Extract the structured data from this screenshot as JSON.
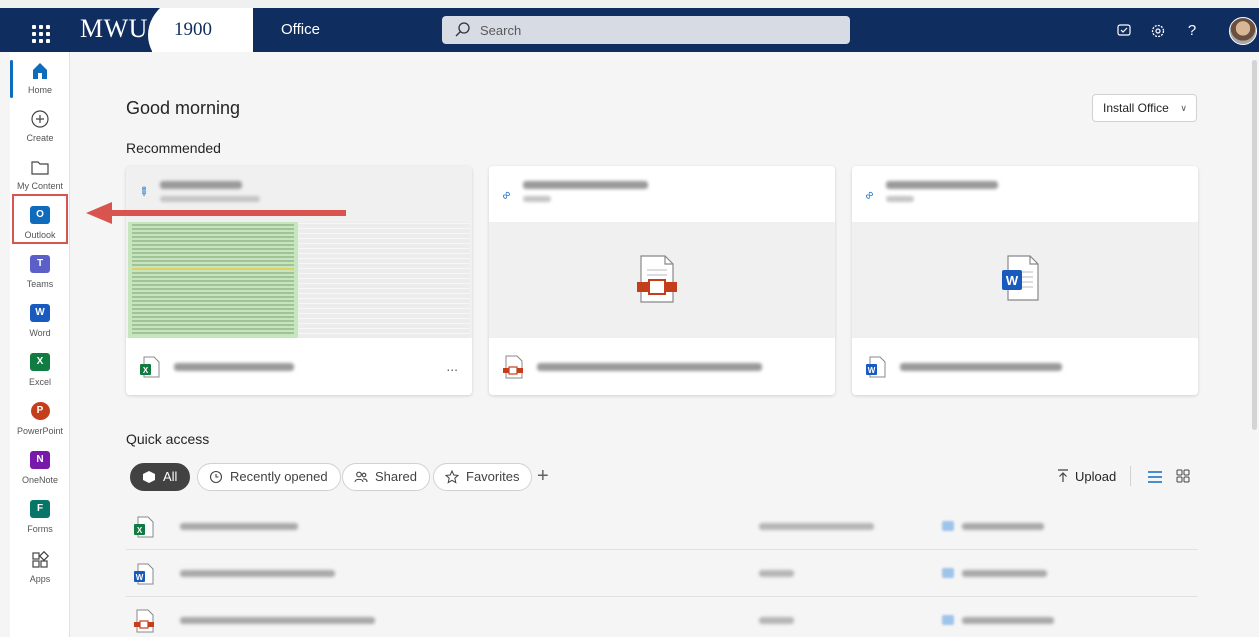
{
  "topbar": {
    "logo_text": "MWU",
    "logo_year": "1900",
    "app_title": "Office",
    "search_placeholder": "Search",
    "icons": [
      "waffle-icon",
      "feedback-icon",
      "settings-gear-icon",
      "help-icon",
      "avatar"
    ]
  },
  "rail": {
    "items": [
      {
        "label": "Home",
        "icon": "home-icon"
      },
      {
        "label": "Create",
        "icon": "plus-circle-icon"
      },
      {
        "label": "My Content",
        "icon": "folder-icon"
      },
      {
        "label": "Outlook",
        "icon": "outlook-icon"
      },
      {
        "label": "Teams",
        "icon": "teams-icon"
      },
      {
        "label": "Word",
        "icon": "word-icon"
      },
      {
        "label": "Excel",
        "icon": "excel-icon"
      },
      {
        "label": "PowerPoint",
        "icon": "powerpoint-icon"
      },
      {
        "label": "OneNote",
        "icon": "onenote-icon"
      },
      {
        "label": "Forms",
        "icon": "forms-icon"
      },
      {
        "label": "Apps",
        "icon": "apps-icon"
      }
    ]
  },
  "main": {
    "greeting": "Good morning",
    "install_button": "Install Office",
    "recommended_title": "Recommended",
    "quick_access_title": "Quick access",
    "filters": [
      {
        "label": "All",
        "active": true
      },
      {
        "label": "Recently opened",
        "active": false
      },
      {
        "label": "Shared",
        "active": false
      },
      {
        "label": "Favorites",
        "active": false
      }
    ],
    "upload_label": "Upload",
    "more_label": "..."
  },
  "colors": {
    "topbar": "#0f2d5e",
    "accent": "#0f6cbd",
    "highlight_box": "#d9534f",
    "excel": "#107c41",
    "word": "#185abd",
    "pdf": "#c43e1c"
  }
}
